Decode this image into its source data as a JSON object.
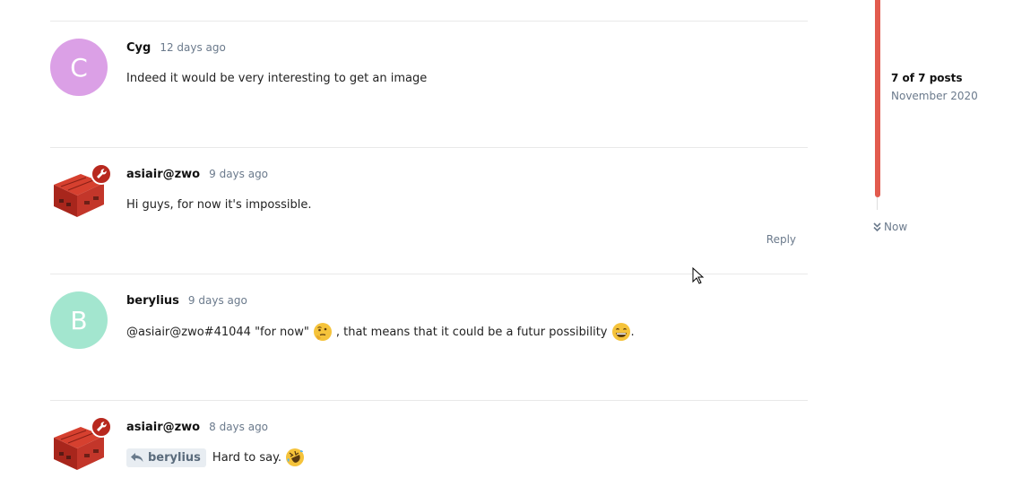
{
  "posts": [
    {
      "username": "Cyg",
      "time": "12 days ago",
      "avatar_letter": "C",
      "avatar_color": "#dba0e6",
      "text": "Indeed it would be very interesting to get an image"
    },
    {
      "username": "asiair@zwo",
      "time": "9 days ago",
      "text": "Hi guys, for now it's impossible.",
      "reply_label": "Reply"
    },
    {
      "username": "berylius",
      "time": "9 days ago",
      "avatar_letter": "B",
      "avatar_color": "#a3e6cf",
      "text_a": "@asiair@zwo#41044 \"for now\"",
      "text_b": ", that means that it could be a futur possibility",
      "text_c": "."
    },
    {
      "username": "asiair@zwo",
      "time": "8 days ago",
      "reply_to": "berylius",
      "text": "Hard to say."
    }
  ],
  "timeline": {
    "count": "7 of 7 posts",
    "date": "November 2020",
    "now_label": "Now",
    "accent": "#e25b4e"
  },
  "icons": {
    "moderator_badge": "wrench-icon",
    "thinking_emoji": "thinking-face-icon",
    "smile_emoji": "grinning-face-icon",
    "rofl_emoji": "rolling-laughing-icon",
    "reply_arrow": "reply-arrow-icon",
    "now_arrow": "double-chevron-down-icon"
  }
}
